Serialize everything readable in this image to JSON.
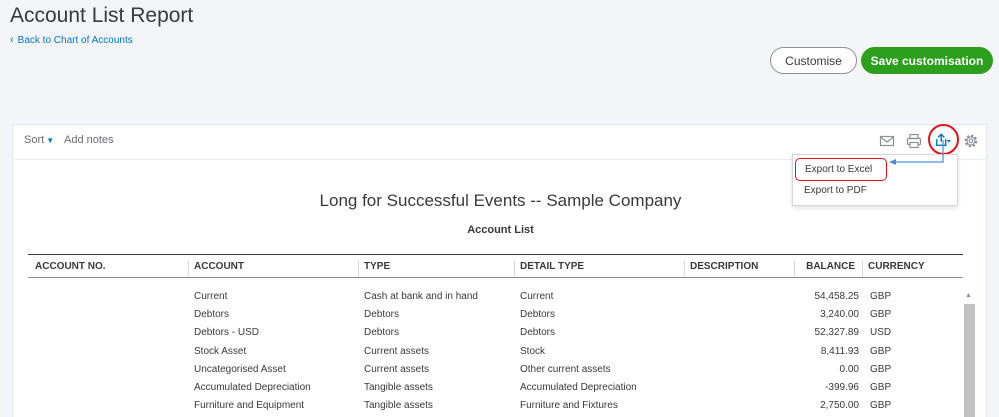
{
  "header": {
    "title": "Account List Report",
    "back_label": "Back to Chart of Accounts",
    "customise_label": "Customise",
    "save_label": "Save customisation"
  },
  "toolbar": {
    "sort_label": "Sort",
    "add_notes_label": "Add notes",
    "icons": [
      "mail-icon",
      "print-icon",
      "export-icon",
      "gear-icon"
    ]
  },
  "export_menu": {
    "items": [
      "Export to Excel",
      "Export to PDF"
    ]
  },
  "report": {
    "company": "Long for Successful Events -- Sample Company",
    "name": "Account List",
    "columns": [
      "ACCOUNT NO.",
      "ACCOUNT",
      "TYPE",
      "DETAIL TYPE",
      "DESCRIPTION",
      "BALANCE",
      "CURRENCY"
    ],
    "rows": [
      {
        "account": "Current",
        "type": "Cash at bank and in hand",
        "detail": "Current",
        "balance": "54,458.25",
        "currency": "GBP"
      },
      {
        "account": "Debtors",
        "type": "Debtors",
        "detail": "Debtors",
        "balance": "3,240.00",
        "currency": "GBP"
      },
      {
        "account": "Debtors - USD",
        "type": "Debtors",
        "detail": "Debtors",
        "balance": "52,327.89",
        "currency": "USD"
      },
      {
        "account": "Stock Asset",
        "type": "Current assets",
        "detail": "Stock",
        "balance": "8,411.93",
        "currency": "GBP"
      },
      {
        "account": "Uncategorised Asset",
        "type": "Current assets",
        "detail": "Other current assets",
        "balance": "0.00",
        "currency": "GBP"
      },
      {
        "account": "Accumulated Depreciation",
        "type": "Tangible assets",
        "detail": "Accumulated Depreciation",
        "balance": "-399.96",
        "currency": "GBP"
      },
      {
        "account": "Furniture and Equipment",
        "type": "Tangible assets",
        "detail": "Furniture and Fixtures",
        "balance": "2,750.00",
        "currency": "GBP"
      }
    ]
  },
  "colors": {
    "accent": "#0077c5",
    "primary_button": "#2ca01c",
    "highlight": "#e0141e"
  }
}
